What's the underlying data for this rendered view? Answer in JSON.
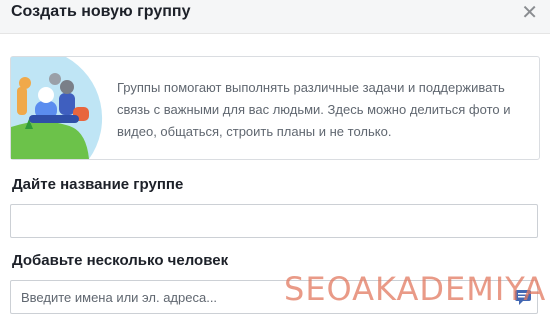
{
  "dialog": {
    "title": "Создать новую группу",
    "close_icon": "close-icon"
  },
  "info": {
    "text": "Группы помогают выполнять различные задачи и поддерживать связь с важными для вас людьми. Здесь можно делиться фото и видео, общаться, строить планы и не только.",
    "illustration": "group-animals-illustration"
  },
  "group_name": {
    "label": "Дайте название группе",
    "value": "",
    "placeholder": ""
  },
  "members": {
    "label": "Добавьте несколько человек",
    "value": "",
    "placeholder": "Введите имена или эл. адреса...",
    "icon": "message-icon"
  },
  "watermark": {
    "text": "SEOAKADEMIYA"
  },
  "colors": {
    "accent": "#4267b2",
    "text": "#1d2129",
    "secondary_text": "#606770",
    "watermark": "#e1785f"
  }
}
